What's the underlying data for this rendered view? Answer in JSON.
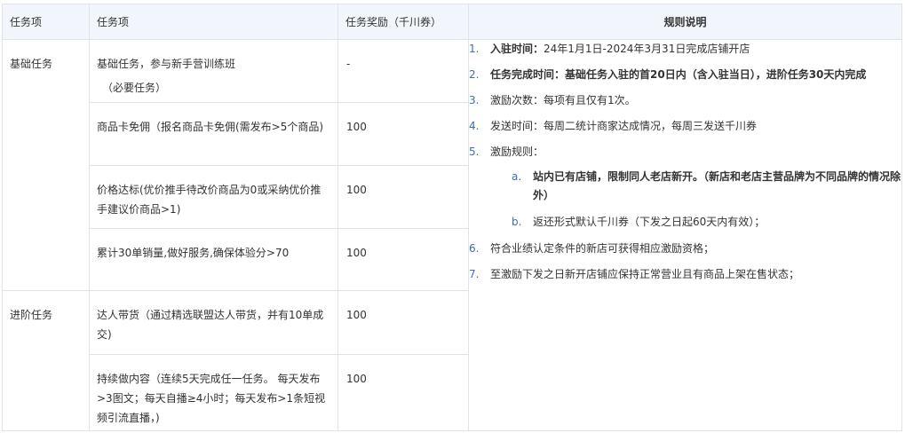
{
  "headers": {
    "col1": "任务项",
    "col2": "任务项",
    "col3": "任务奖励（千川券）",
    "col4": "规则说明"
  },
  "categories": {
    "basic": "基础任务",
    "advanced": "进阶任务"
  },
  "tasks": [
    {
      "name": "基础任务，参与新手营训练班",
      "note": "（必要任务）",
      "reward": "-"
    },
    {
      "name": "商品卡免佣（报名商品卡免佣(需发布>5个商品)",
      "note": "",
      "reward": "100"
    },
    {
      "name": "价格达标(优价推手待改价商品为0或采纳优价推手建议价商品>1)",
      "note": "",
      "reward": "100"
    },
    {
      "name": "累计30单销量,做好服务,确保体验分>70",
      "note": "",
      "reward": "100"
    },
    {
      "name": "达人带货（通过精选联盟达人带货，并有10单成交)",
      "note": "",
      "reward": "100"
    },
    {
      "name": "持续做内容（连续5天完成任一任务。 每天发布>3图文；每天自播≥4小时；每天发布>1条短视频引流直播，)",
      "note": "",
      "reward": "100"
    }
  ],
  "rules": {
    "r1_num": "1.",
    "r1_label": "入驻时间：",
    "r1_text": "24年1月1日-2024年3月31日完成店铺开店",
    "r2_num": "2.",
    "r2_text": "任务完成时间：基础任务入驻的首20日内（含入驻当日），进阶任务30天内完成",
    "r3_num": "3.",
    "r3_text": "激励次数：每项有且仅有1次。",
    "r4_num": "4.",
    "r4_text": "发送时间：每周二统计商家达成情况，每周三发送千川券",
    "r5_num": "5.",
    "r5_text": "激励规则：",
    "r5a_num": "a.",
    "r5a_text": "站内已有店铺，限制同人老店新开。（新店和老店主营品牌为不同品牌的情况除外）",
    "r5b_num": "b.",
    "r5b_text": "返还形式默认千川券（下发之日起60天内有效）；",
    "r6_num": "6.",
    "r6_text": " 符合业绩认定条件的新店可获得相应激励资格；",
    "r7_num": "7.",
    "r7_text": "至激励下发之日新开店铺应保持正常营业且有商品上架在售状态；"
  },
  "colors": {
    "border": "#dfe3ea",
    "header_bg": "#f2f6fc",
    "number_accent": "#3a6fb8"
  }
}
